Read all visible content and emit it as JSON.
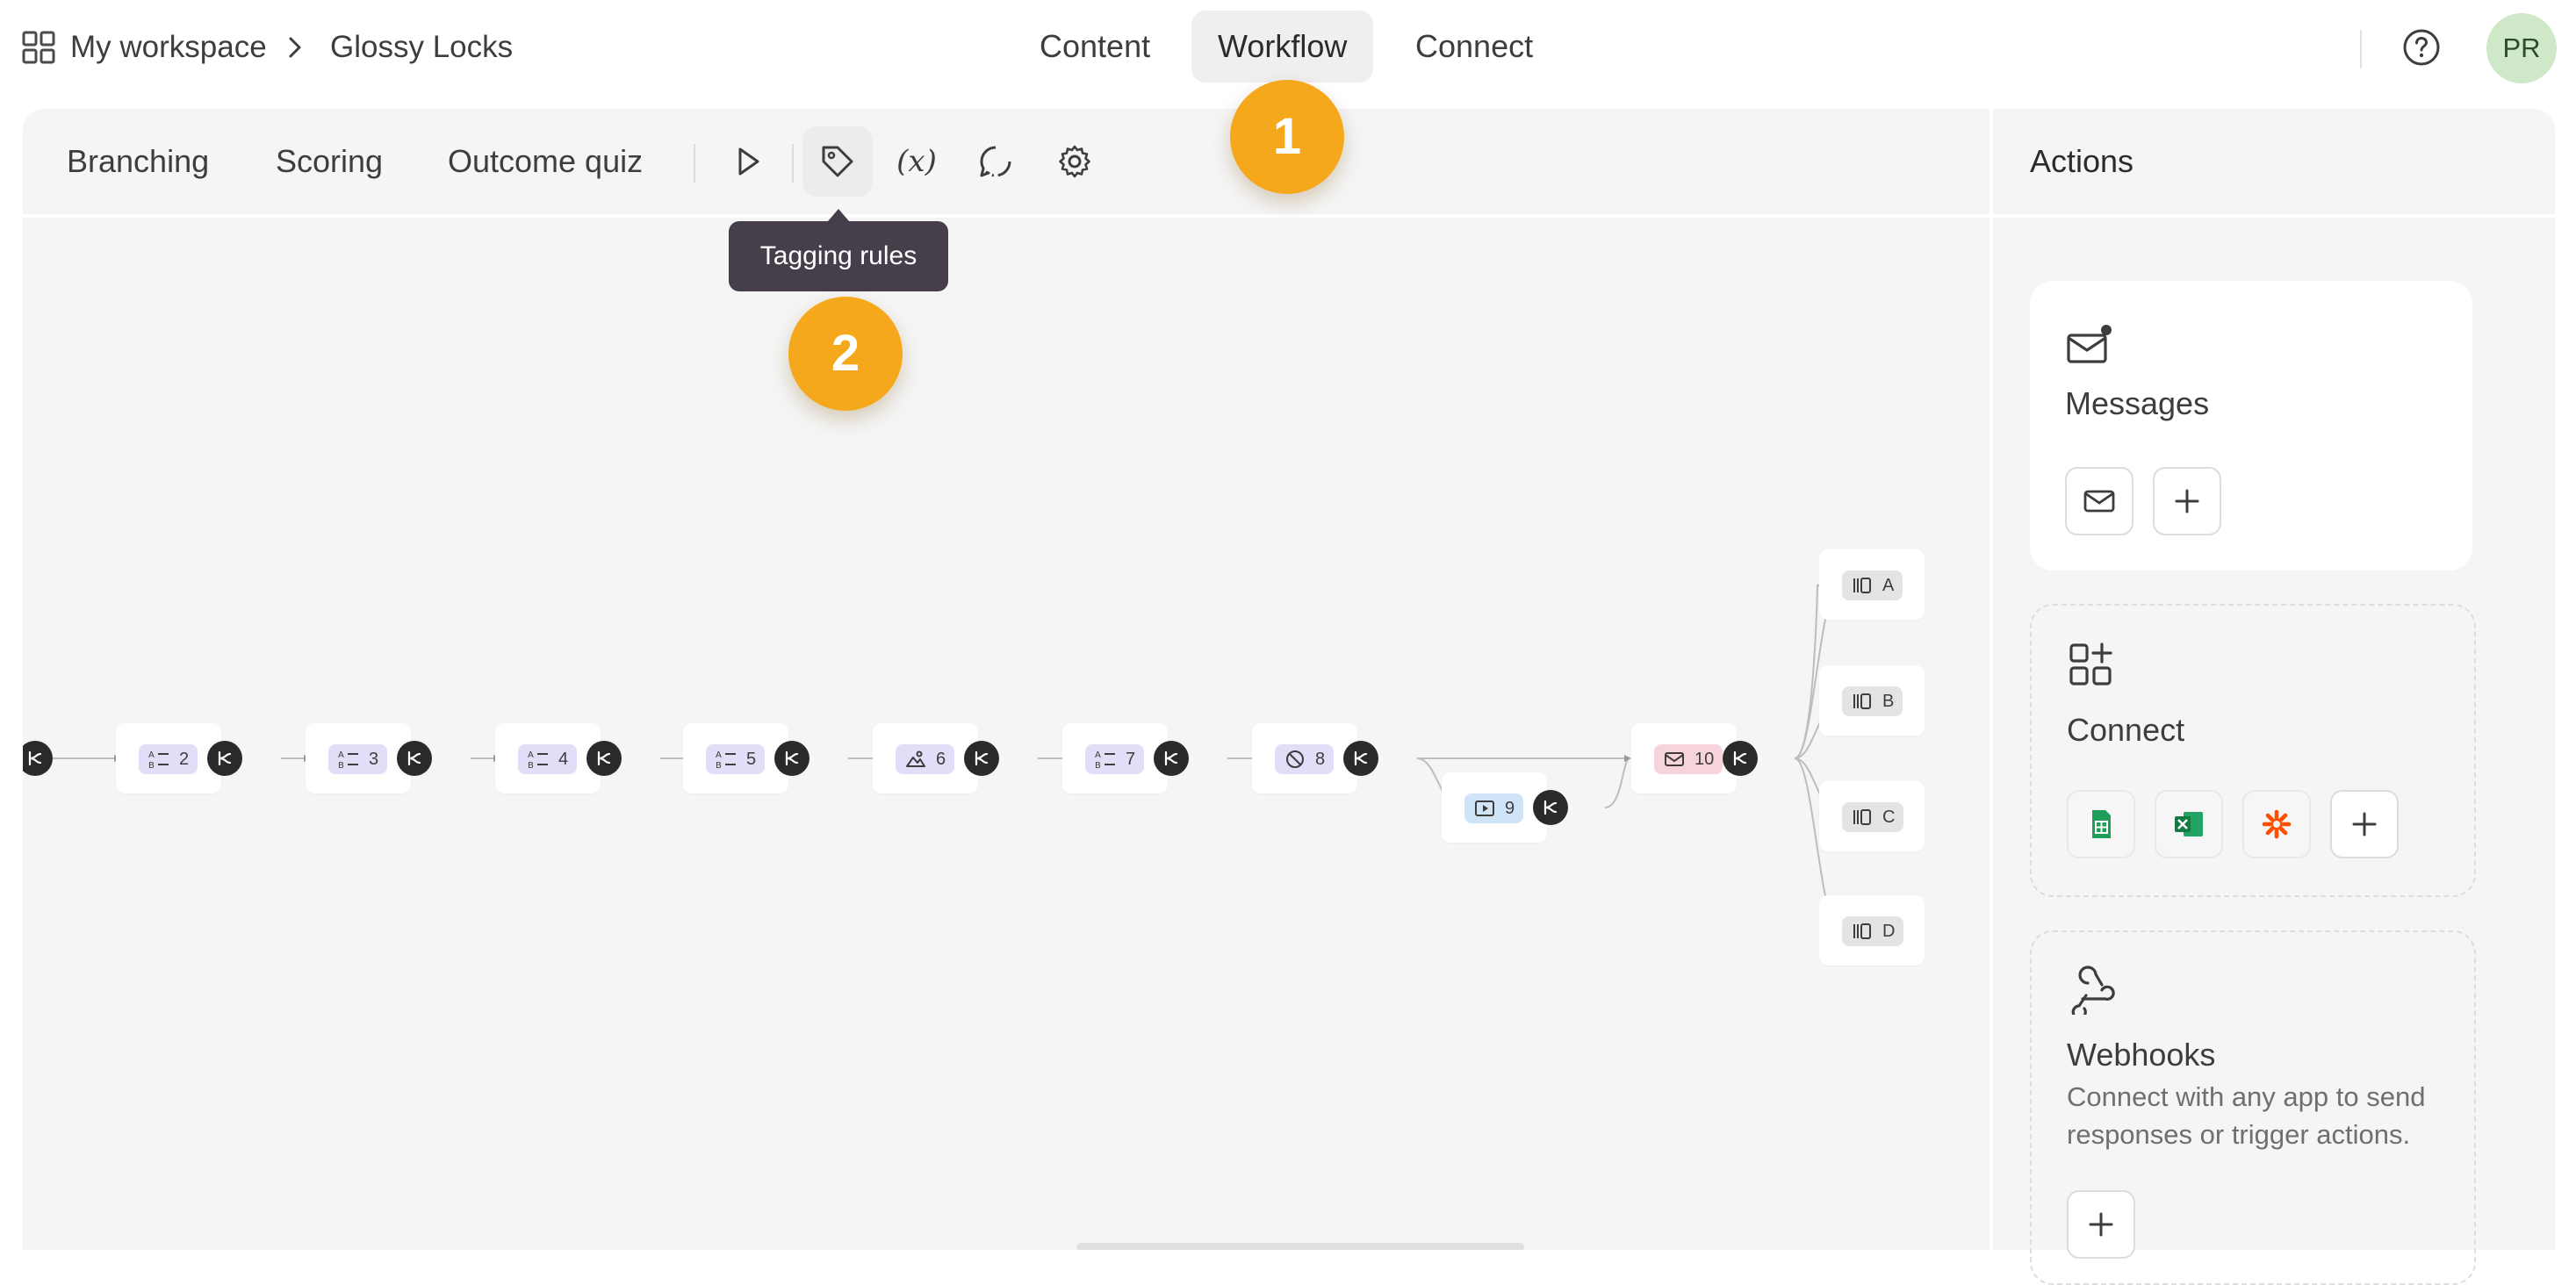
{
  "header": {
    "workspace": "My workspace",
    "form_name": "Glossy Locks",
    "tabs": [
      {
        "label": "Content"
      },
      {
        "label": "Workflow"
      },
      {
        "label": "Connect"
      }
    ],
    "active_tab": "Workflow",
    "avatar_initials": "PR"
  },
  "toolbar": {
    "links": [
      "Branching",
      "Scoring",
      "Outcome quiz"
    ],
    "icons": [
      "preview-icon",
      "tag-icon",
      "variable-icon",
      "loading-icon",
      "settings-icon"
    ],
    "tooltip": "Tagging rules"
  },
  "markers": [
    "1",
    "2"
  ],
  "flow": {
    "nodes": [
      {
        "type": "question",
        "number": "2"
      },
      {
        "type": "question",
        "number": "3"
      },
      {
        "type": "question",
        "number": "4"
      },
      {
        "type": "question",
        "number": "5"
      },
      {
        "type": "picture-choice",
        "number": "6"
      },
      {
        "type": "question",
        "number": "7"
      },
      {
        "type": "hidden",
        "number": "8"
      },
      {
        "type": "video",
        "number": "9"
      },
      {
        "type": "message",
        "number": "10"
      }
    ],
    "outcomes": [
      "A",
      "B",
      "C",
      "D"
    ]
  },
  "actions": {
    "title": "Actions",
    "messages": {
      "title": "Messages"
    },
    "connect": {
      "title": "Connect",
      "apps": [
        "google-sheets",
        "excel",
        "zapier"
      ]
    },
    "webhooks": {
      "title": "Webhooks",
      "description": "Connect with any app to send responses or trigger actions."
    }
  },
  "colors": {
    "marker": "#f6a81c",
    "tooltip": "#463e4a",
    "question_chip": "#e3ddf7",
    "video_chip": "#cfe4f7",
    "message_chip": "#f7d4dc",
    "avatar": "#cfe8c8"
  }
}
